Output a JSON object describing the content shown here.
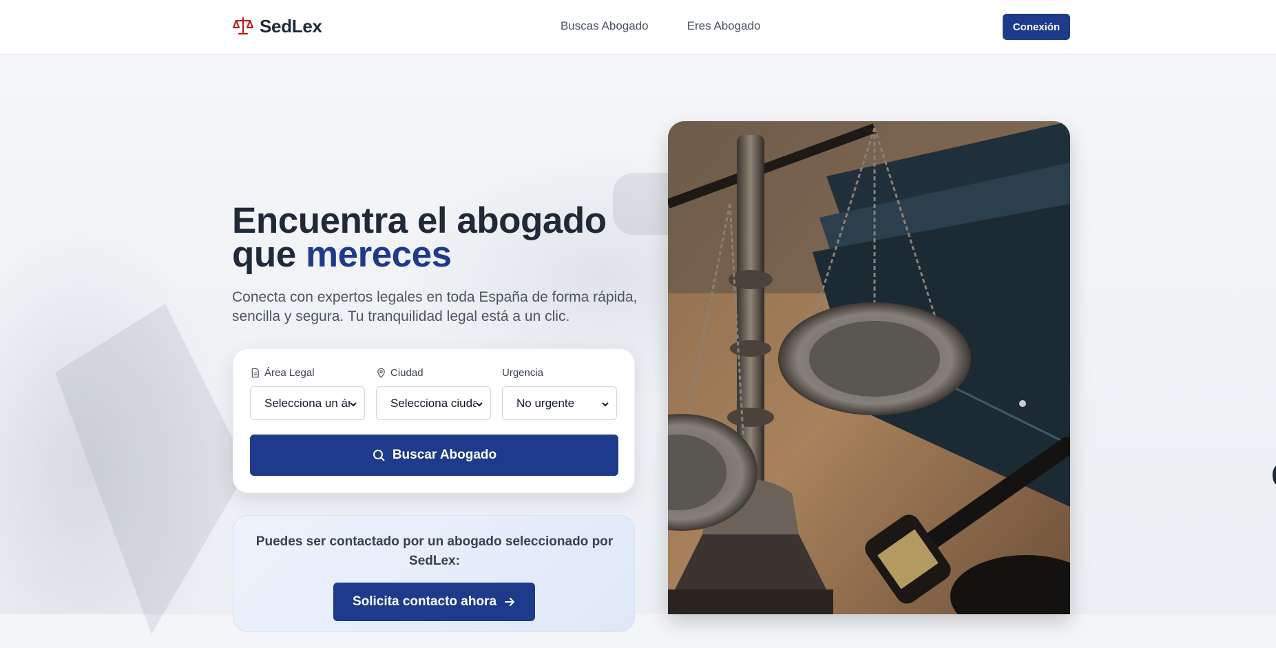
{
  "header": {
    "logo_text": "SedLex",
    "nav": [
      {
        "label": "Buscas Abogado"
      },
      {
        "label": "Eres Abogado"
      }
    ],
    "login_label": "Conexión"
  },
  "hero": {
    "title_line1": "Encuentra el abogado",
    "title_line2_prefix": "que",
    "title_line2_accent": "mereces",
    "subtitle": "Conecta con expertos legales en toda España de forma rápida, sencilla y segura. Tu tranquilidad legal está a un clic."
  },
  "search": {
    "fields": [
      {
        "label": "Área Legal",
        "value": "Selecciona un área",
        "icon": "document-icon"
      },
      {
        "label": "Ciudad",
        "value": "Selecciona ciudad",
        "icon": "location-pin-icon"
      },
      {
        "label": "Urgencia",
        "value": "No urgente",
        "icon": ""
      }
    ],
    "button_label": "Buscar Abogado"
  },
  "contact": {
    "text": "Puedes ser contactado por un abogado seleccionado por SedLex:",
    "button_label": "Solicita contacto ahora"
  },
  "colors": {
    "brand": "#1e3a8a",
    "logo_red": "#b91c1c",
    "text_dark": "#1f2937",
    "text_muted": "#4b5563"
  }
}
